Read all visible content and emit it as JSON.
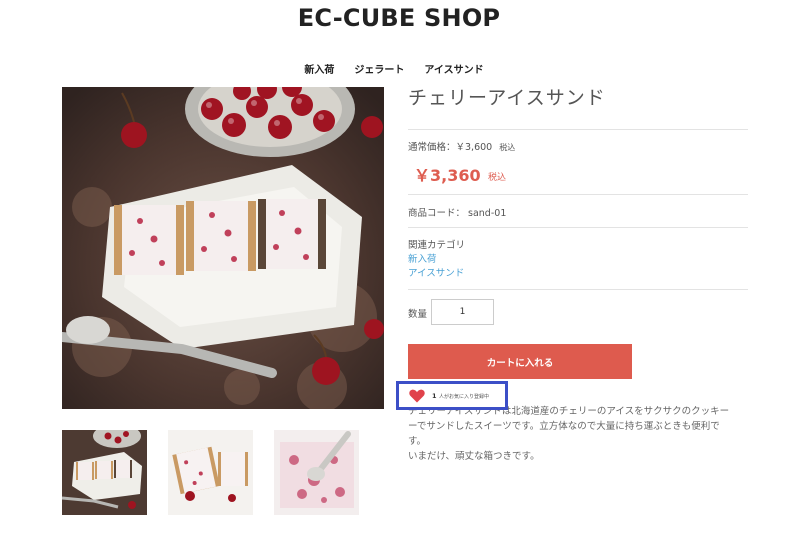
{
  "shop": {
    "title": "EC-CUBE SHOP"
  },
  "nav": {
    "items": [
      "新入荷",
      "ジェラート",
      "アイスサンド"
    ]
  },
  "product": {
    "name": "チェリーアイスサンド",
    "normal_price_label": "通常価格：￥3,600",
    "normal_price_tax": "税込",
    "sale_price": "￥3,360",
    "sale_price_tax": "税込",
    "code": "商品コード： sand-01",
    "category_label": "関連カテゴリ",
    "categories": [
      "新入荷",
      "アイスサンド"
    ],
    "quantity_label": "数量",
    "quantity_value": "1",
    "cart_button": "カートに入れる",
    "description_lines": [
      "チェリーアイスサンドは北海道産のチェリーのアイスをサクサクのクッキー",
      "ーでサンドしたスイーツです。立方体なので大量に持ち運ぶときも便利で",
      "す。",
      "いまだけ、頑丈な箱つきです。"
    ]
  },
  "favorite": {
    "count": "1",
    "text": "人がお気に入り登録中",
    "heart_color": "#e0424b",
    "highlight_color": "#3c4fc7"
  },
  "colors": {
    "accent": "#de5b4e",
    "link": "#4aa1d4"
  },
  "images": {
    "main": "cherry-ice-sandwich-photo",
    "thumbnails": [
      "cherry-ice-sandwich-thumb-1",
      "cherry-ice-sandwich-thumb-2",
      "cherry-ice-sandwich-thumb-3"
    ]
  }
}
